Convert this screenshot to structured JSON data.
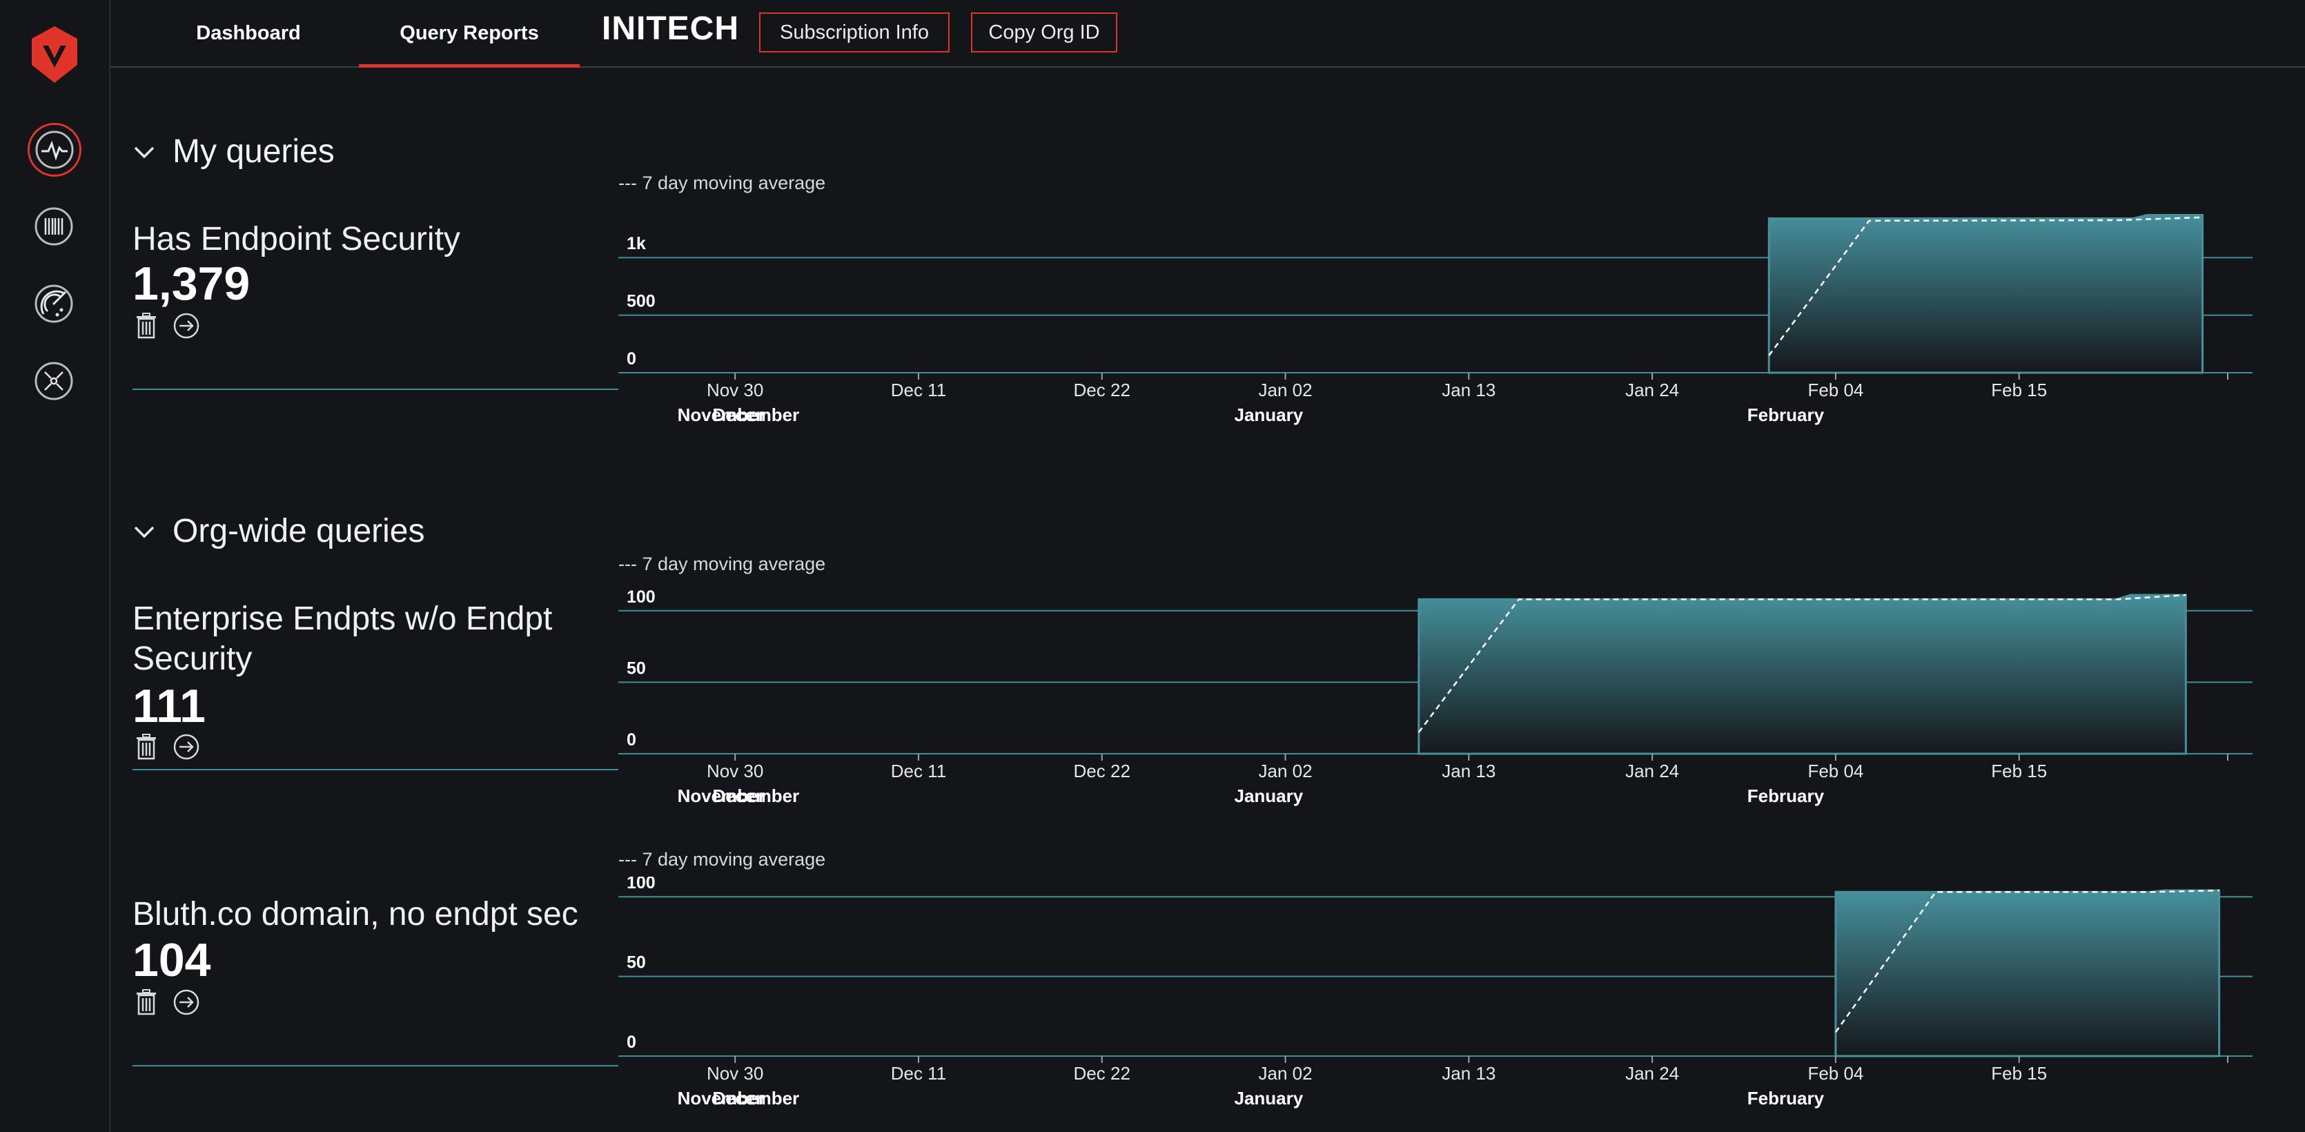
{
  "app": {
    "tabs": [
      {
        "label": "Dashboard",
        "active": false
      },
      {
        "label": "Query Reports",
        "active": true
      }
    ],
    "org_name": "INITECH",
    "buttons": {
      "subscription": "Subscription Info",
      "copy_org": "Copy Org ID"
    },
    "sidebar_icons": [
      "shield-logo-icon",
      "activity-icon",
      "barcode-icon",
      "radar-icon",
      "network-icon"
    ],
    "colors": {
      "accent": "#e0342a",
      "chart_line": "#3e8d99",
      "area_top": "#46909c",
      "bg": "#131519"
    }
  },
  "sections": [
    {
      "title": "My queries"
    },
    {
      "title": "Org-wide queries"
    }
  ],
  "queries": [
    {
      "name": "Has Endpoint Security",
      "count": "1,379",
      "legend": "--- 7 day moving average"
    },
    {
      "name": "Enterprise Endpts w/o Endpt Security",
      "count": "111",
      "legend": "--- 7 day moving average"
    },
    {
      "name": "Bluth.co domain, no endpt sec",
      "count": "104",
      "legend": "--- 7 day moving average"
    }
  ],
  "chart_data": [
    {
      "type": "area",
      "x_ticks": [
        "Nov 30",
        "Dec 11",
        "Dec 22",
        "Jan 02",
        "Jan 13",
        "Jan 24",
        "Feb 04",
        "Feb 15"
      ],
      "month_labels": [
        "November",
        "December",
        "January",
        "February"
      ],
      "y_ticks": [
        "0",
        "500",
        "1k"
      ],
      "ylim": [
        0,
        1379
      ],
      "series": [
        {
          "name": "count",
          "x": [
            "2020-01-31",
            "2020-02-26"
          ],
          "values": [
            1340,
            1370
          ]
        },
        {
          "name": "7 day moving average",
          "x": [
            "2020-01-31",
            "2020-02-06",
            "2020-02-21",
            "2020-02-26"
          ],
          "values": [
            150,
            1320,
            1325,
            1350
          ]
        }
      ]
    },
    {
      "type": "area",
      "x_ticks": [
        "Nov 30",
        "Dec 11",
        "Dec 22",
        "Jan 02",
        "Jan 13",
        "Jan 24",
        "Feb 04",
        "Feb 15"
      ],
      "month_labels": [
        "November",
        "December",
        "January",
        "February"
      ],
      "y_ticks": [
        "0",
        "50",
        "100"
      ],
      "ylim": [
        0,
        111
      ],
      "series": [
        {
          "name": "count",
          "x": [
            "2020-01-10",
            "2020-02-25"
          ],
          "values": [
            108,
            111
          ]
        },
        {
          "name": "7 day moving average",
          "x": [
            "2020-01-10",
            "2020-01-16",
            "2020-02-21",
            "2020-02-25"
          ],
          "values": [
            15,
            108,
            108,
            111
          ]
        }
      ]
    },
    {
      "type": "area",
      "x_ticks": [
        "Nov 30",
        "Dec 11",
        "Dec 22",
        "Jan 02",
        "Jan 13",
        "Jan 24",
        "Feb 04",
        "Feb 15"
      ],
      "month_labels": [
        "November",
        "December",
        "January",
        "February"
      ],
      "y_ticks": [
        "0",
        "50",
        "100"
      ],
      "ylim": [
        0,
        104
      ],
      "series": [
        {
          "name": "count",
          "x": [
            "2020-02-04",
            "2020-02-27"
          ],
          "values": [
            103,
            104
          ]
        },
        {
          "name": "7 day moving average",
          "x": [
            "2020-02-04",
            "2020-02-10",
            "2020-02-23",
            "2020-02-27"
          ],
          "values": [
            15,
            103,
            103,
            104
          ]
        }
      ]
    }
  ]
}
